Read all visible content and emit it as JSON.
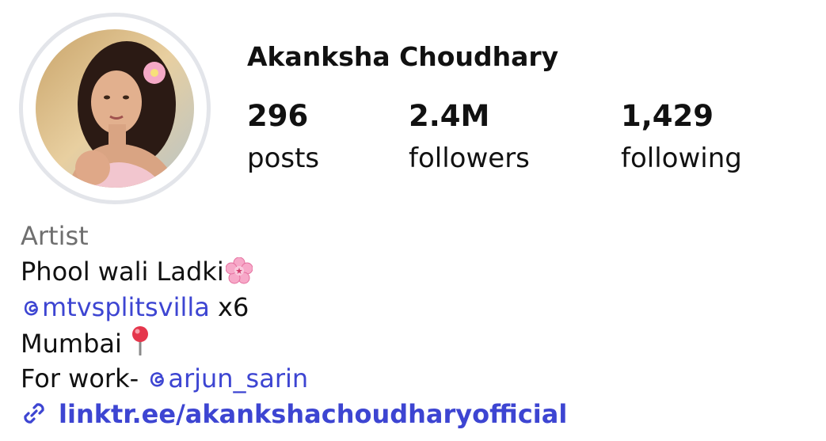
{
  "profile": {
    "name": "Akanksha Choudhary",
    "avatar_alt": "profile-photo"
  },
  "stats": {
    "posts": {
      "count": "296",
      "label": "posts"
    },
    "followers": {
      "count": "2.4M",
      "label": "followers"
    },
    "following": {
      "count": "1,429",
      "label": "following"
    }
  },
  "bio": {
    "category": "Artist",
    "line1": "Phool wali Ladki",
    "line2_mention": "mtvsplitsvilla",
    "line2_suffix": " x6",
    "line3": "Mumbai",
    "line4_prefix": "For work- ",
    "line4_mention": "arjun_sarin",
    "link": "linktr.ee/akankshachoudharyofficial"
  },
  "icons": {
    "flower": "cherry-blossom-icon",
    "pin": "round-pushpin-icon",
    "threads": "threads-at-icon",
    "link": "chain-link-icon"
  },
  "colors": {
    "link": "#3d45d2",
    "category": "#6f6f6f",
    "avatar_ring": "#e3e5ea",
    "text": "#111111"
  }
}
